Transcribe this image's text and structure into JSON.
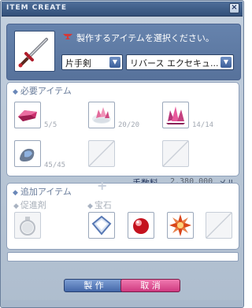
{
  "window": {
    "title": "ITEM CREATE",
    "close": "×"
  },
  "top": {
    "instruction": "製作するアイテムを選択ください。",
    "category": {
      "value": "片手剣"
    },
    "item": {
      "value": "リバース エクセキュ..."
    }
  },
  "required": {
    "header": "必要アイテム",
    "items": [
      {
        "icon": "pink-ingot-icon",
        "count": "5/5"
      },
      {
        "icon": "pink-crystal-ore-icon",
        "count": "20/20"
      },
      {
        "icon": "crystal-cluster-icon",
        "count": "14/14"
      },
      {
        "icon": "blue-ore-icon",
        "count": "45/45"
      },
      {
        "icon": "empty-slot",
        "count": ""
      },
      {
        "icon": "empty-slot",
        "count": ""
      }
    ]
  },
  "fee": {
    "label": "手数料",
    "value": "2,380,000",
    "unit": "メル"
  },
  "additional": {
    "header": "追加アイテム",
    "catalyst_label": "促進剤",
    "gem_label": "宝石",
    "plus": "+"
  },
  "buttons": {
    "make": "製 作",
    "cancel": "取 消"
  },
  "progress": 0,
  "colors": {
    "titlebar": "#3a5a88",
    "accent": "#5c78a3",
    "cancel": "#d94a8e",
    "make": "#5477b8"
  }
}
